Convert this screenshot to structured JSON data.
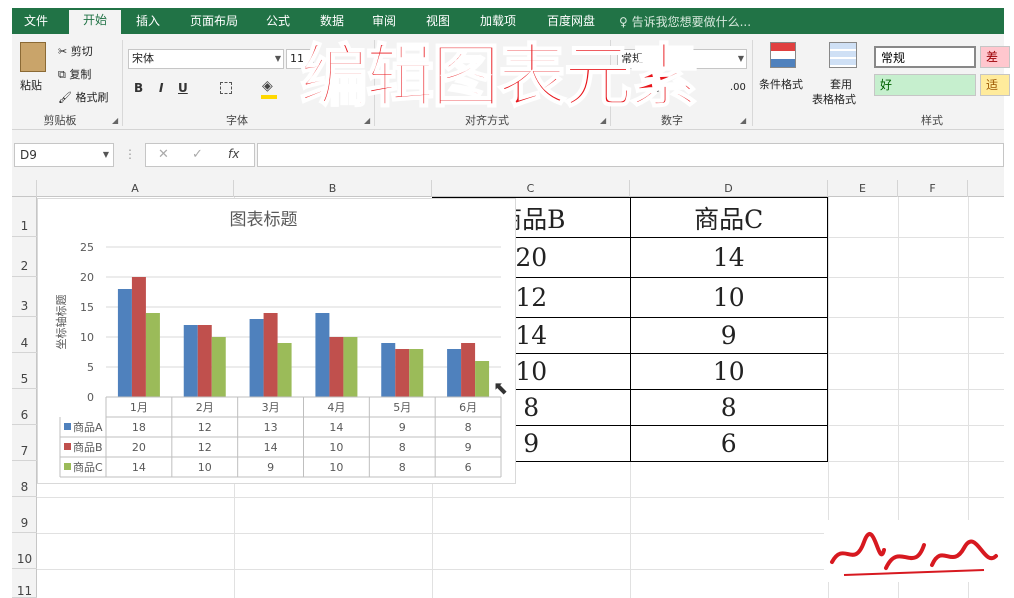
{
  "tabs": [
    "文件",
    "开始",
    "插入",
    "页面布局",
    "公式",
    "数据",
    "审阅",
    "视图",
    "加载项",
    "百度网盘"
  ],
  "active_tab": "开始",
  "tell_me": "告诉我您想要做什么...",
  "clipboard": {
    "paste": "粘贴",
    "cut": "剪切",
    "copy": "复制",
    "format_painter": "格式刷",
    "group": "剪贴板"
  },
  "font": {
    "name": "宋体",
    "size": "11",
    "bold": "B",
    "italic": "I",
    "underline": "U",
    "group": "字体"
  },
  "alignment": {
    "group": "对齐方式"
  },
  "number": {
    "format": "常规",
    "group": "数字",
    "percent": "%",
    "decimal": ".00"
  },
  "styles_group": {
    "conditional": "条件格式",
    "table_format": "套用\n表格格式",
    "table_format_1": "套用",
    "table_format_2": "表格格式",
    "normal": "常规",
    "bad": "差",
    "good": "好",
    "neutral": "适",
    "group": "样式"
  },
  "name_box": "D9",
  "formula_cancel": "✕",
  "formula_enter": "✓",
  "formula_fx": "fx",
  "formula_value": "",
  "columns": [
    "A",
    "B",
    "C",
    "D",
    "E",
    "F"
  ],
  "rows": [
    "1",
    "2",
    "3",
    "4",
    "5",
    "6",
    "7",
    "8",
    "9",
    "10",
    "11"
  ],
  "table": {
    "header": [
      "商品B",
      "商品C"
    ],
    "rows": [
      [
        "20",
        "14"
      ],
      [
        "12",
        "10"
      ],
      [
        "14",
        "9"
      ],
      [
        "10",
        "10"
      ],
      [
        "8",
        "8"
      ],
      [
        "9",
        "6"
      ]
    ]
  },
  "overlay_title": "编辑图表元素",
  "signature": "紫之峰",
  "colors": {
    "excel_green": "#217346",
    "series_a": "#4f81bd",
    "series_b": "#c0504d",
    "series_c": "#9bbb59",
    "overlay": "#e8141a"
  },
  "chart_data": {
    "type": "bar",
    "title": "图表标题",
    "ylabel": "坐标轴标题",
    "xlabel": "",
    "categories": [
      "1月",
      "2月",
      "3月",
      "4月",
      "5月",
      "6月"
    ],
    "series": [
      {
        "name": "商品A",
        "values": [
          18,
          12,
          13,
          14,
          9,
          8
        ]
      },
      {
        "name": "商品B",
        "values": [
          20,
          12,
          14,
          10,
          8,
          9
        ]
      },
      {
        "name": "商品C",
        "values": [
          14,
          10,
          9,
          10,
          8,
          6
        ]
      }
    ],
    "ylim": [
      0,
      25
    ],
    "yticks": [
      "0",
      "5",
      "10",
      "15",
      "20",
      "25"
    ],
    "grid": true,
    "data_table": true
  }
}
